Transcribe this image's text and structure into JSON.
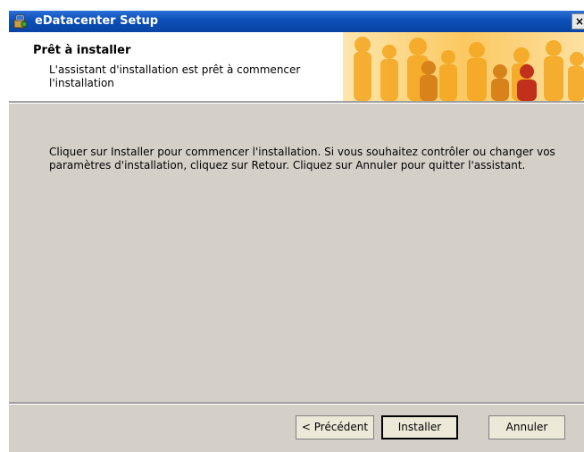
{
  "window": {
    "title": "eDatacenter Setup",
    "close_label": "×"
  },
  "header": {
    "title": "Prêt à installer",
    "subtitle": "L'assistant d'installation est prêt à commencer l'installation"
  },
  "main": {
    "text": "Cliquer sur Installer pour commencer l'installation. Si vous souhaitez contrôler ou changer vos paramètres d'installation, cliquez sur Retour. Cliquez sur Annuler pour quitter l'assistant."
  },
  "footer": {
    "back_label": "< Précédent",
    "install_label": "Installer",
    "cancel_label": "Annuler"
  },
  "colors": {
    "titlebar": "#0b4fb8",
    "dialog_bg": "#d4d0c8",
    "banner_orange": "#f0a020"
  },
  "icons": {
    "app": "setup-package-icon",
    "banner": "people-silhouette-banner"
  }
}
